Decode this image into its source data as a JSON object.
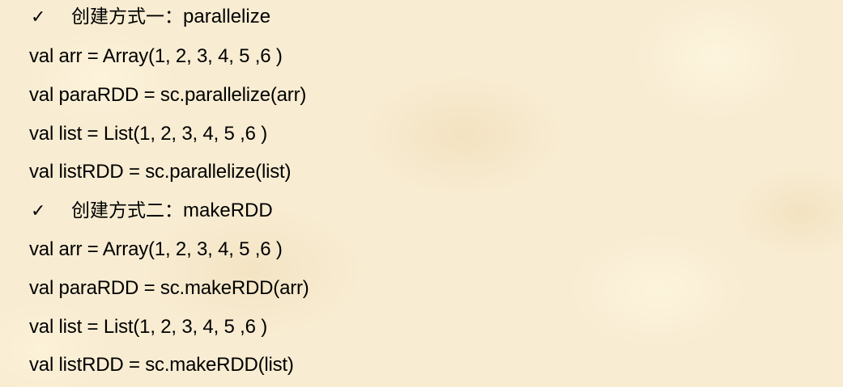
{
  "sections": [
    {
      "heading_cn": "创建方式一：",
      "heading_en": "parallelize",
      "lines": [
        "val arr = Array(1, 2, 3, 4, 5 ,6 )",
        "val paraRDD = sc.parallelize(arr)",
        "val list = List(1, 2, 3, 4, 5 ,6 )",
        "val listRDD = sc.parallelize(list)"
      ]
    },
    {
      "heading_cn": "创建方式二：",
      "heading_en": "makeRDD",
      "lines": [
        "val arr = Array(1, 2, 3, 4, 5 ,6 )",
        "val paraRDD = sc.makeRDD(arr)",
        "val list = List(1, 2, 3, 4, 5 ,6 )",
        "val listRDD = sc.makeRDD(list)"
      ]
    }
  ],
  "bullet_glyph": "✓",
  "colors": {
    "background": "#f8ecd2",
    "text": "#000000"
  }
}
